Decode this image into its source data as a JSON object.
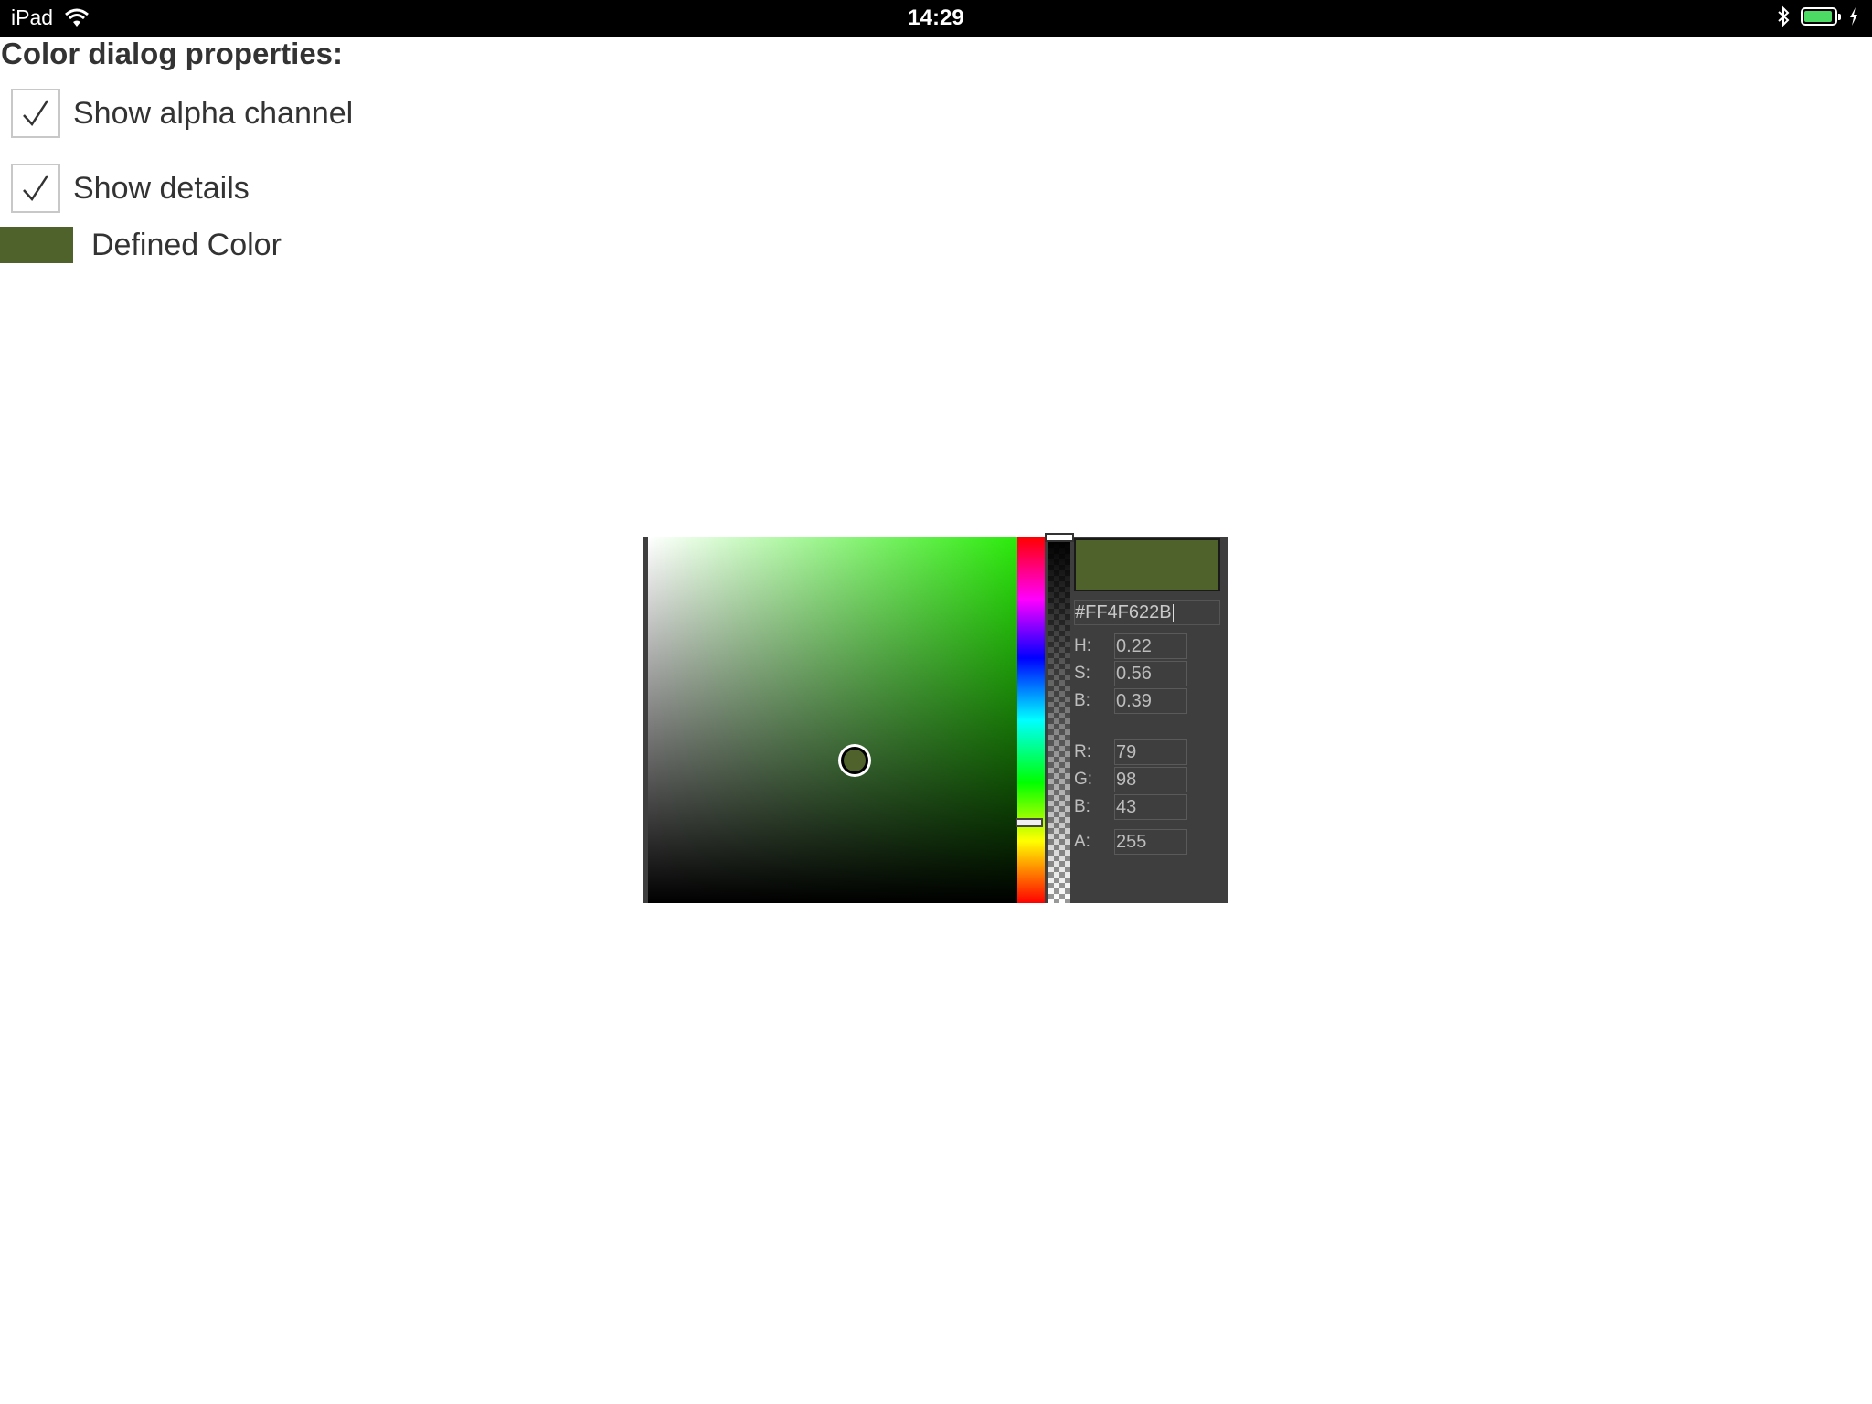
{
  "status_bar": {
    "device": "iPad",
    "time": "14:29"
  },
  "properties": {
    "title": "Color dialog properties:",
    "show_alpha_label": "Show alpha channel",
    "show_alpha_checked": true,
    "show_details_label": "Show details",
    "show_details_checked": true,
    "defined_color_label": "Defined Color",
    "defined_color_hex": "#4f622b"
  },
  "dialog": {
    "preview_color": "#4f622b",
    "hex": "#FF4F622B",
    "hue": 0.22,
    "saturation": 0.56,
    "brightness": 0.39,
    "alpha_fraction": 1.0,
    "fields": {
      "h_label": "H:",
      "h_value": "0.22",
      "s_label": "S:",
      "s_value": "0.56",
      "b_label": "B:",
      "b_value": "0.39",
      "r_label": "R:",
      "r_value": "79",
      "g_label": "G:",
      "g_value": "98",
      "b2_label": "B:",
      "b2_value": "43",
      "a_label": "A:",
      "a_value": "255"
    }
  },
  "colors": {
    "status_bar_bg": "#000000",
    "battery_fill": "#4cd964",
    "dialog_bg": "#3e3e3e",
    "sv_hue_color": "#2bea0b"
  }
}
